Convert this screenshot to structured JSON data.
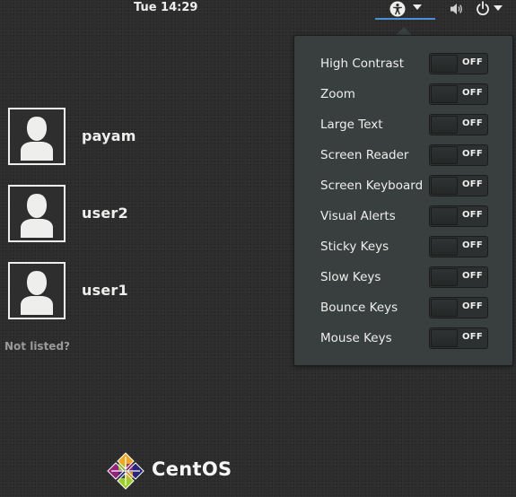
{
  "topbar": {
    "clock": "Tue 14:29",
    "accessibility_icon": "accessibility-person-icon",
    "volume_icon": "volume-icon",
    "power_icon": "power-icon"
  },
  "users": [
    {
      "name": "payam",
      "avatar_icon": "user-silhouette-icon"
    },
    {
      "name": "user2",
      "avatar_icon": "user-silhouette-icon"
    },
    {
      "name": "user1",
      "avatar_icon": "user-silhouette-icon"
    }
  ],
  "not_listed": "Not listed?",
  "logo": {
    "text": "CentOS",
    "icon": "centos-logo-icon"
  },
  "accessibility_menu": {
    "items": [
      {
        "label": "High Contrast",
        "state": "OFF"
      },
      {
        "label": "Zoom",
        "state": "OFF"
      },
      {
        "label": "Large Text",
        "state": "OFF"
      },
      {
        "label": "Screen Reader",
        "state": "OFF"
      },
      {
        "label": "Screen Keyboard",
        "state": "OFF"
      },
      {
        "label": "Visual Alerts",
        "state": "OFF"
      },
      {
        "label": "Sticky Keys",
        "state": "OFF"
      },
      {
        "label": "Slow Keys",
        "state": "OFF"
      },
      {
        "label": "Bounce Keys",
        "state": "OFF"
      },
      {
        "label": "Mouse Keys",
        "state": "OFF"
      }
    ]
  },
  "colors": {
    "background": "#2c2c2c",
    "popup": "#393f3f",
    "accent": "#4a90d9",
    "text": "#eeeeec"
  }
}
